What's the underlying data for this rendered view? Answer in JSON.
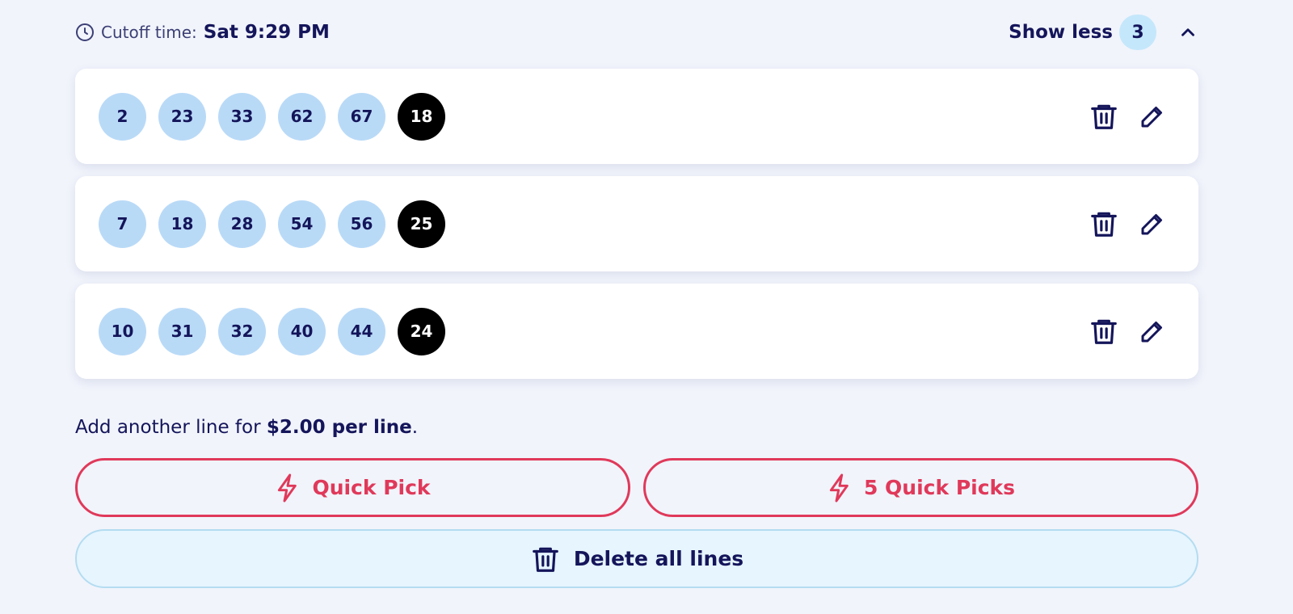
{
  "header": {
    "cutoff_label": "Cutoff time:",
    "cutoff_value": "Sat 9:29 PM",
    "toggle_label": "Show less",
    "line_count": "3"
  },
  "lines": [
    {
      "numbers": [
        "2",
        "23",
        "33",
        "62",
        "67"
      ],
      "bonus": "18"
    },
    {
      "numbers": [
        "7",
        "18",
        "28",
        "54",
        "56"
      ],
      "bonus": "25"
    },
    {
      "numbers": [
        "10",
        "31",
        "32",
        "40",
        "44"
      ],
      "bonus": "24"
    }
  ],
  "price_note": {
    "prefix": "Add another line for ",
    "price": "$2.00 per line",
    "suffix": "."
  },
  "buttons": {
    "quick_pick": "Quick Pick",
    "five_quick_picks": "5 Quick Picks",
    "delete_all": "Delete all lines"
  },
  "icons": {
    "clock": "clock-icon",
    "chevron": "chevron-up-icon",
    "trash": "trash-icon",
    "pencil": "pencil-icon",
    "bolt": "lightning-icon"
  },
  "colors": {
    "primary_text": "#14155a",
    "accent_red": "#e0395a",
    "ball_blue": "#b9daf7",
    "bonus_black": "#000000",
    "badge_blue": "#c5e7fb"
  }
}
